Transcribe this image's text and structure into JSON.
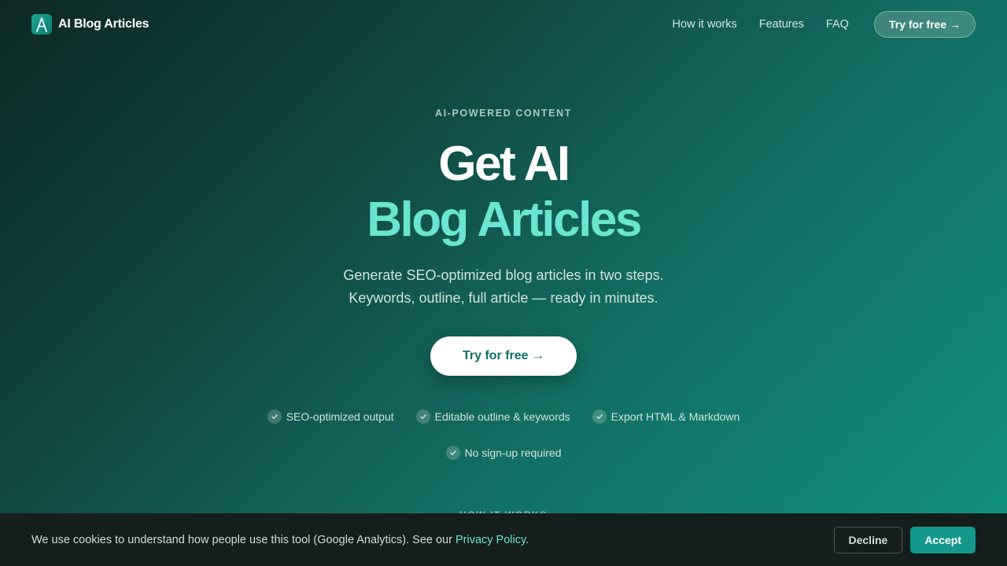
{
  "header": {
    "brand": "AI Blog Articles",
    "logo_icon": "a-letter-logo-icon",
    "nav": [
      "How it works",
      "Features",
      "FAQ"
    ],
    "cta": "Try for free →"
  },
  "hero": {
    "eyebrow": "AI-POWERED CONTENT",
    "title_line1": "Get AI",
    "title_line2": "Blog Articles",
    "subtitle_line1": "Generate SEO-optimized blog articles in two steps.",
    "subtitle_line2": "Keywords, outline, full article — ready in minutes.",
    "cta": "Try for free →",
    "features": [
      "SEO-optimized output",
      "Editable outline & keywords",
      "Export HTML & Markdown",
      "No sign-up required"
    ]
  },
  "next_section_label": "HOW IT WORKS",
  "cookie": {
    "text": "We use cookies to understand how people use this tool (Google Analytics). See our ",
    "link": "Privacy Policy",
    "suffix": ".",
    "decline": "Decline",
    "accept": "Accept"
  },
  "colors": {
    "accent": "#6ae5cf",
    "accept_button": "#14988a",
    "cookie_bg": "#141e1c",
    "cta_text": "#0f6f63"
  }
}
